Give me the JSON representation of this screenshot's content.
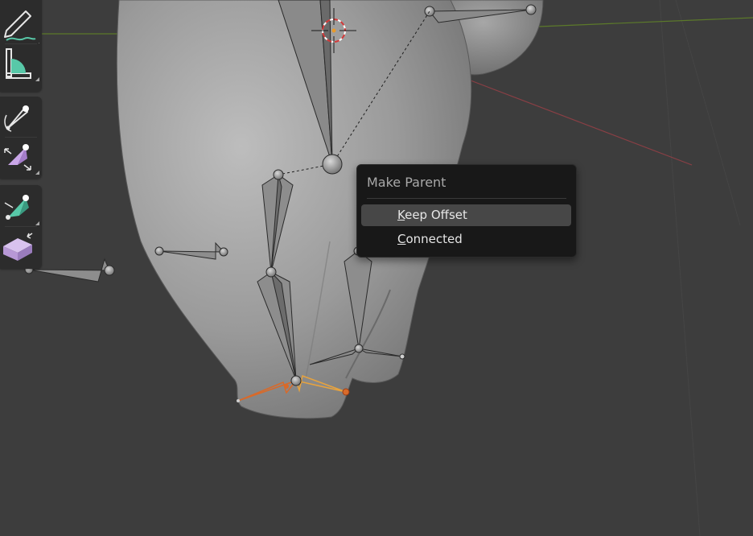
{
  "viewport": {
    "colors": {
      "background": "#3d3d3d",
      "grid_line": "#474747",
      "x_axis": "#8a3f45",
      "y_axis": "#5c7a2a",
      "mesh": "#8f8f8f",
      "bone": "#7d7d7d",
      "selected_bone": "#e8a33d",
      "selected_bone_active": "#d86a2a"
    }
  },
  "toolbar": {
    "tools": [
      {
        "name": "annotate-tool",
        "icon": "annotate-icon"
      },
      {
        "name": "measure-tool",
        "icon": "ruler-protractor-icon"
      },
      {
        "name": "roll-tool",
        "icon": "bone-roll-icon"
      },
      {
        "name": "bone-size-tool",
        "icon": "bone-envelope-icon"
      },
      {
        "name": "extrude-tool",
        "icon": "bone-extrude-icon"
      },
      {
        "name": "transform-tool",
        "icon": "shear-box-icon"
      }
    ]
  },
  "context_menu": {
    "title": "Make Parent",
    "items": [
      {
        "label": "Keep Offset",
        "accel": "K",
        "rest": "eep Offset",
        "active": true
      },
      {
        "label": "Connected",
        "accel": "C",
        "rest": "onnected",
        "active": false
      }
    ]
  }
}
